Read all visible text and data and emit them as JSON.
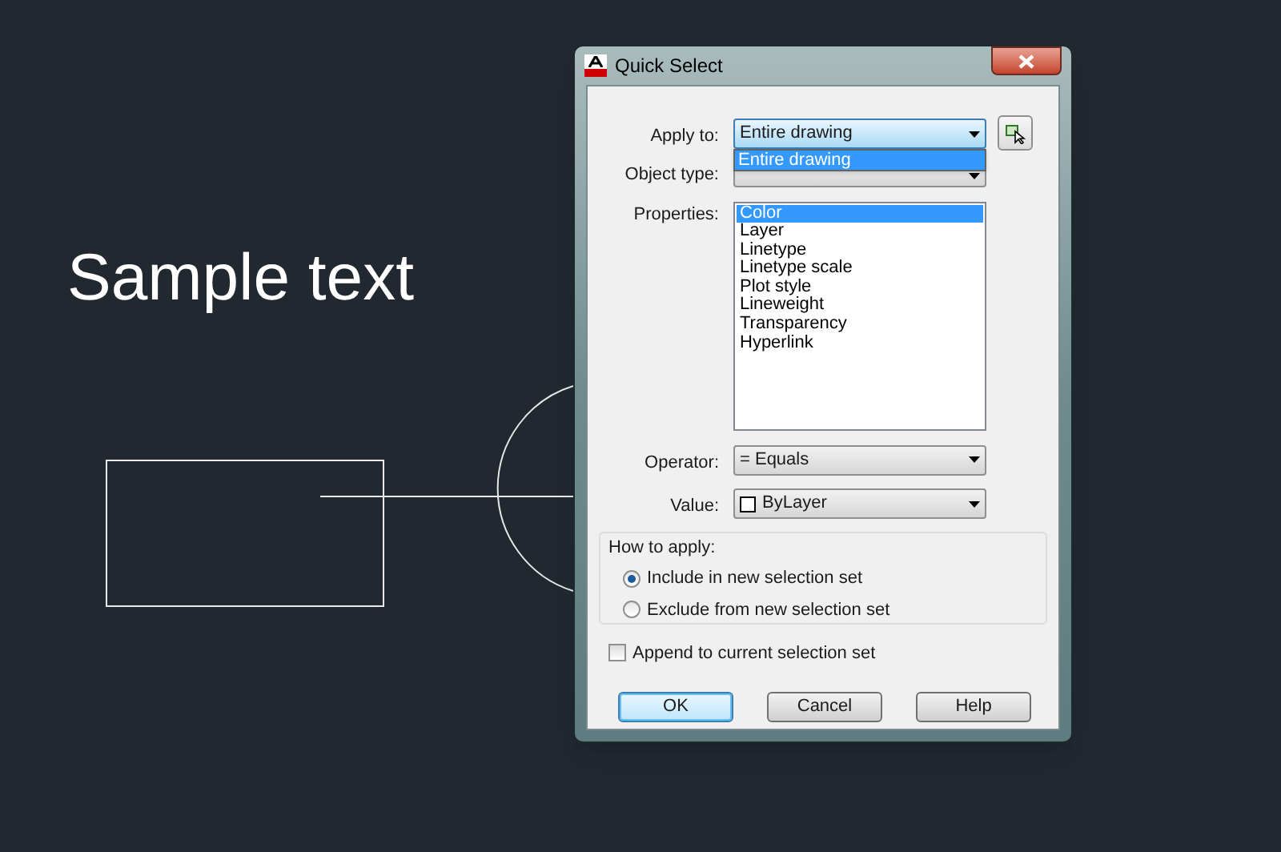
{
  "window": {
    "title": "Quick Select"
  },
  "canvas": {
    "text": "Sample text"
  },
  "apply_to": {
    "label": "Apply to:",
    "value": "Entire drawing",
    "expanded": true,
    "options": [
      {
        "label": "Entire drawing",
        "selected": true
      }
    ]
  },
  "object_type": {
    "label": "Object type:"
  },
  "properties": {
    "label": "Properties:",
    "items": [
      {
        "label": "Color",
        "selected": true
      },
      {
        "label": "Layer",
        "selected": false
      },
      {
        "label": "Linetype",
        "selected": false
      },
      {
        "label": "Linetype scale",
        "selected": false
      },
      {
        "label": "Plot style",
        "selected": false
      },
      {
        "label": "Lineweight",
        "selected": false
      },
      {
        "label": "Transparency",
        "selected": false
      },
      {
        "label": "Hyperlink",
        "selected": false
      }
    ]
  },
  "operator": {
    "label": "Operator:",
    "value": "= Equals"
  },
  "value": {
    "label": "Value:",
    "value": "ByLayer"
  },
  "how_to_apply": {
    "title": "How to apply:",
    "options": [
      {
        "label": "Include in new selection set",
        "selected": true
      },
      {
        "label": "Exclude from new selection set",
        "selected": false
      }
    ]
  },
  "append": {
    "label": "Append to current selection set",
    "checked": false
  },
  "buttons": [
    {
      "label": "OK",
      "default": true
    },
    {
      "label": "Cancel",
      "default": false
    },
    {
      "label": "Help",
      "default": false
    }
  ]
}
